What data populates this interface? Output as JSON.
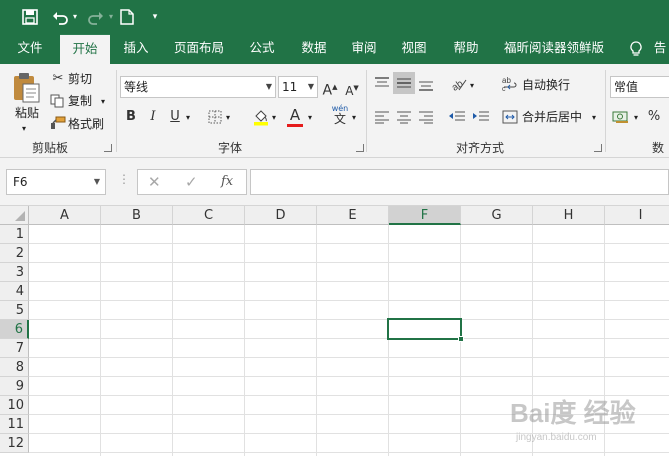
{
  "quick_access": {
    "icons": [
      "save-icon",
      "undo-icon",
      "redo-icon",
      "new-file-icon",
      "customize-icon"
    ]
  },
  "tabs": [
    {
      "label": "文件"
    },
    {
      "label": "开始",
      "active": true
    },
    {
      "label": "插入"
    },
    {
      "label": "页面布局"
    },
    {
      "label": "公式"
    },
    {
      "label": "数据"
    },
    {
      "label": "审阅"
    },
    {
      "label": "视图"
    },
    {
      "label": "帮助"
    },
    {
      "label": "福昕阅读器领鲜版"
    },
    {
      "label": "告"
    }
  ],
  "clipboard": {
    "paste": "粘贴",
    "cut": "剪切",
    "copy": "复制",
    "format_painter": "格式刷",
    "group_label": "剪贴板"
  },
  "font": {
    "name": "等线",
    "size": "11",
    "grow": "A",
    "shrink": "A",
    "bold": "B",
    "italic": "I",
    "underline": "U",
    "font_color": "A",
    "phonetic_top": "wén",
    "phonetic_bottom": "文",
    "group_label": "字体"
  },
  "alignment": {
    "wrap_text": "自动换行",
    "merge_center": "合并后居中",
    "group_label": "对齐方式"
  },
  "number": {
    "format": "常值",
    "percent": "%",
    "group_label": "数"
  },
  "formula_bar": {
    "name_box": "F6",
    "cancel": "✕",
    "enter": "✓",
    "fx": "fx",
    "formula": ""
  },
  "grid": {
    "columns": [
      "A",
      "B",
      "C",
      "D",
      "E",
      "F",
      "G",
      "H",
      "I"
    ],
    "rows": [
      "1",
      "2",
      "3",
      "4",
      "5",
      "6",
      "7",
      "8",
      "9",
      "10",
      "11",
      "12"
    ],
    "selected_column": "F",
    "selected_row": "6",
    "active_cell": "F6"
  },
  "watermark": {
    "text": "Bai度 经验",
    "sub": "jingyan.baidu.com"
  },
  "colors": {
    "accent": "#217346",
    "ribbon_bg": "#f3f3f3",
    "header_bg": "#efefef",
    "selected_header_bg": "#d2d2d2"
  }
}
